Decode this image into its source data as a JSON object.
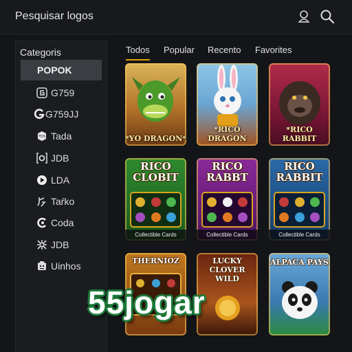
{
  "header": {
    "search_label": "Pesquisar logos",
    "icons": [
      "profile-icon",
      "search-icon"
    ]
  },
  "sidebar": {
    "heading": "Categoris",
    "items": [
      {
        "label": "POPOK",
        "icon": "none",
        "active": true
      },
      {
        "label": "G759",
        "icon": "g759-logo-icon"
      },
      {
        "label": "G759JJ",
        "icon": "g-logo-icon"
      },
      {
        "label": "Tada",
        "icon": "tada-logo-icon"
      },
      {
        "label": "JDB",
        "icon": "jdb-logo-icon"
      },
      {
        "label": "LDA",
        "icon": "play-icon"
      },
      {
        "label": "Taŕko",
        "icon": "tarko-logo-icon"
      },
      {
        "label": "Coda",
        "icon": "coda-logo-icon"
      },
      {
        "label": "JDB",
        "icon": "jdb-star-logo-icon"
      },
      {
        "label": "Uinhos",
        "icon": "uinhos-logo-icon"
      }
    ]
  },
  "tabs": [
    {
      "label": "Todos",
      "active": true
    },
    {
      "label": "Popular"
    },
    {
      "label": "Recento"
    },
    {
      "label": "Favorites"
    }
  ],
  "games": [
    {
      "title": "*YO DRAGON*",
      "caption": "",
      "theme": "dragon"
    },
    {
      "title": "*RICO DRAGON",
      "caption": "",
      "theme": "rabbit"
    },
    {
      "title": "*RICO RABBIT",
      "caption": "",
      "theme": "gorilla"
    },
    {
      "title": "RICO CLOBIT",
      "caption": "Collectible Cards",
      "theme": "slot-green"
    },
    {
      "title": "RICO RABBT",
      "caption": "Collectible Cards",
      "theme": "slot-purple"
    },
    {
      "title": "RICO RABBIT",
      "caption": "Collectible Cards",
      "theme": "slot-blue"
    },
    {
      "title": "THERNIOZ",
      "caption": "",
      "theme": "slot-orange"
    },
    {
      "title": "LUCKY CLOVER WILD",
      "caption": "",
      "theme": "clover"
    },
    {
      "title": "ALPACA PAYS",
      "caption": "",
      "theme": "panda"
    }
  ],
  "watermark": "55jogar",
  "colors": {
    "background": "#131518",
    "accent": "#e0a100",
    "watermark_outline": "#1e7a3a"
  }
}
